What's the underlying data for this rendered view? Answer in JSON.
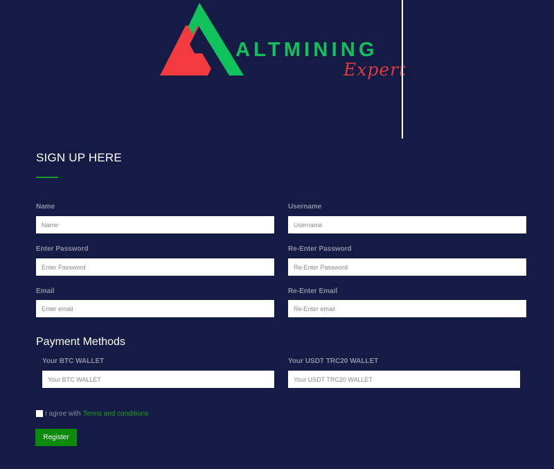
{
  "brand": {
    "name": "ALTMINING",
    "tagline": "Expert",
    "colors": {
      "primary_red": "#f23a3f",
      "primary_green": "#10c25b"
    }
  },
  "form": {
    "title": "SIGN UP HERE",
    "fields": {
      "name": {
        "label": "Name",
        "placeholder": "Name"
      },
      "username": {
        "label": "Username",
        "placeholder": "Username"
      },
      "password": {
        "label": "Enter Password",
        "placeholder": "Enter Password"
      },
      "password_confirm": {
        "label": "Re-Enter Password",
        "placeholder": "Re-Enter Password"
      },
      "email": {
        "label": "Email",
        "placeholder": "Enter email"
      },
      "email_confirm": {
        "label": "Re-Enter Email",
        "placeholder": "Re-Enter email"
      }
    },
    "payment": {
      "title": "Payment Methods",
      "btc": {
        "label": "Your BTC WALLET",
        "placeholder": "Your BTC WALLET"
      },
      "usdt": {
        "label": "Your USDT TRC20 WALLET",
        "placeholder": "Your USDT TRC20 WALLET"
      }
    },
    "agree": {
      "text": "I agree with",
      "link_text": "Terms and conditions",
      "checked": false
    },
    "submit_label": "Register",
    "colors": {
      "background": "#141c45",
      "accent": "#0c8a0c",
      "link": "#1ea025"
    }
  }
}
